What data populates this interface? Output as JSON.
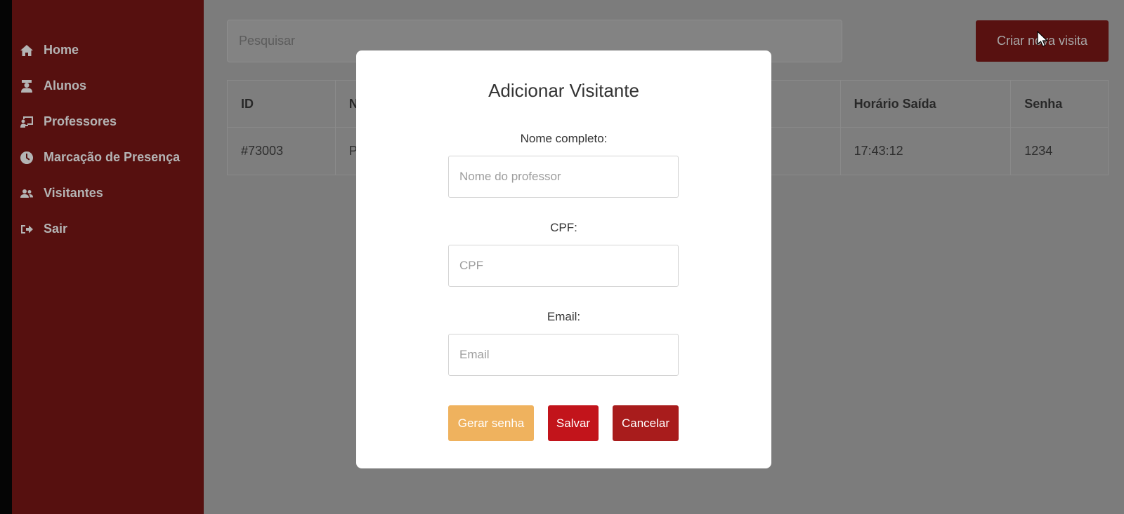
{
  "sidebar": {
    "items": [
      {
        "label": "Home",
        "icon": "home-icon"
      },
      {
        "label": "Alunos",
        "icon": "student-icon"
      },
      {
        "label": "Professores",
        "icon": "teacher-icon"
      },
      {
        "label": "Marcação de Presença",
        "icon": "clock-icon"
      },
      {
        "label": "Visitantes",
        "icon": "users-icon"
      },
      {
        "label": "Sair",
        "icon": "sign-out-icon"
      }
    ]
  },
  "main": {
    "search_placeholder": "Pesquisar",
    "create_button": "Criar nova visita",
    "table": {
      "headers": [
        "ID",
        "N",
        "Horário Saída",
        "Senha"
      ],
      "rows": [
        [
          "#73003",
          "P",
          "17:43:12",
          "1234"
        ]
      ]
    }
  },
  "modal": {
    "title": "Adicionar Visitante",
    "fields": [
      {
        "label": "Nome completo:",
        "placeholder": "Nome do professor"
      },
      {
        "label": "CPF:",
        "placeholder": "CPF"
      },
      {
        "label": "Email:",
        "placeholder": "Email"
      }
    ],
    "buttons": {
      "generate": "Gerar senha",
      "save": "Salvar",
      "cancel": "Cancelar"
    }
  },
  "colors": {
    "sidebar": "#56100f",
    "overlay": "#7c7c7c",
    "generate": "#efb25e",
    "save": "#c2141b",
    "cancel": "#a81c1c"
  }
}
